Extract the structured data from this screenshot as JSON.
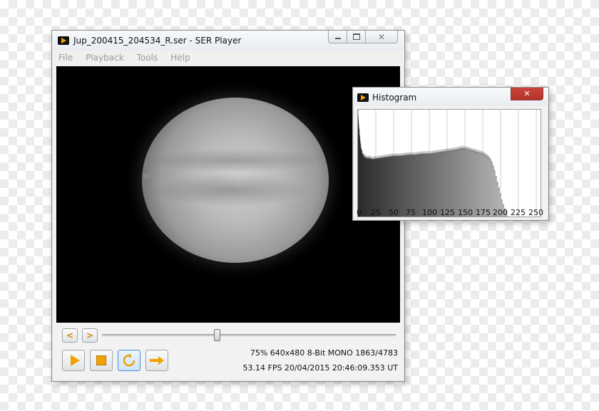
{
  "player": {
    "title": "Jup_200415_204534_R.ser - SER Player",
    "menu": [
      "File",
      "Playback",
      "Tools",
      "Help"
    ],
    "transport": {
      "prev_label": "<",
      "next_label": ">",
      "slider_position_fraction": 0.39
    },
    "status_line1": "75%  640x480  8-Bit  MONO  1863/4783",
    "status_line2": "53.14 FPS  20/04/2015 20:46:09.353 UT"
  },
  "histogram": {
    "title": "Histogram",
    "close_label": "✕",
    "accent_color": "#c9463d"
  },
  "chart_data": {
    "type": "bar",
    "title": "",
    "xlabel": "",
    "ylabel": "",
    "xlim": [
      0,
      256
    ],
    "ylim": [
      0,
      100
    ],
    "x_ticks": [
      "0",
      "25",
      "50",
      "75",
      "100",
      "125",
      "150",
      "175",
      "200",
      "225",
      "250"
    ],
    "grid": true,
    "profile": [
      [
        0,
        98
      ],
      [
        2,
        80
      ],
      [
        4,
        66
      ],
      [
        6,
        60
      ],
      [
        8,
        57
      ],
      [
        10,
        56
      ],
      [
        12,
        55
      ],
      [
        16,
        55
      ],
      [
        20,
        54
      ],
      [
        30,
        55
      ],
      [
        40,
        56
      ],
      [
        50,
        57
      ],
      [
        60,
        57
      ],
      [
        70,
        58
      ],
      [
        80,
        58
      ],
      [
        90,
        59
      ],
      [
        100,
        59
      ],
      [
        110,
        60
      ],
      [
        120,
        61
      ],
      [
        130,
        62
      ],
      [
        140,
        63
      ],
      [
        145,
        64
      ],
      [
        150,
        64
      ],
      [
        155,
        63
      ],
      [
        160,
        62
      ],
      [
        165,
        61
      ],
      [
        170,
        60
      ],
      [
        175,
        59
      ],
      [
        180,
        57
      ],
      [
        185,
        54
      ],
      [
        188,
        50
      ],
      [
        191,
        44
      ],
      [
        194,
        36
      ],
      [
        197,
        28
      ],
      [
        200,
        20
      ],
      [
        202,
        14
      ],
      [
        204,
        10
      ],
      [
        206,
        6
      ],
      [
        208,
        4
      ],
      [
        210,
        0
      ],
      [
        256,
        0
      ]
    ]
  }
}
